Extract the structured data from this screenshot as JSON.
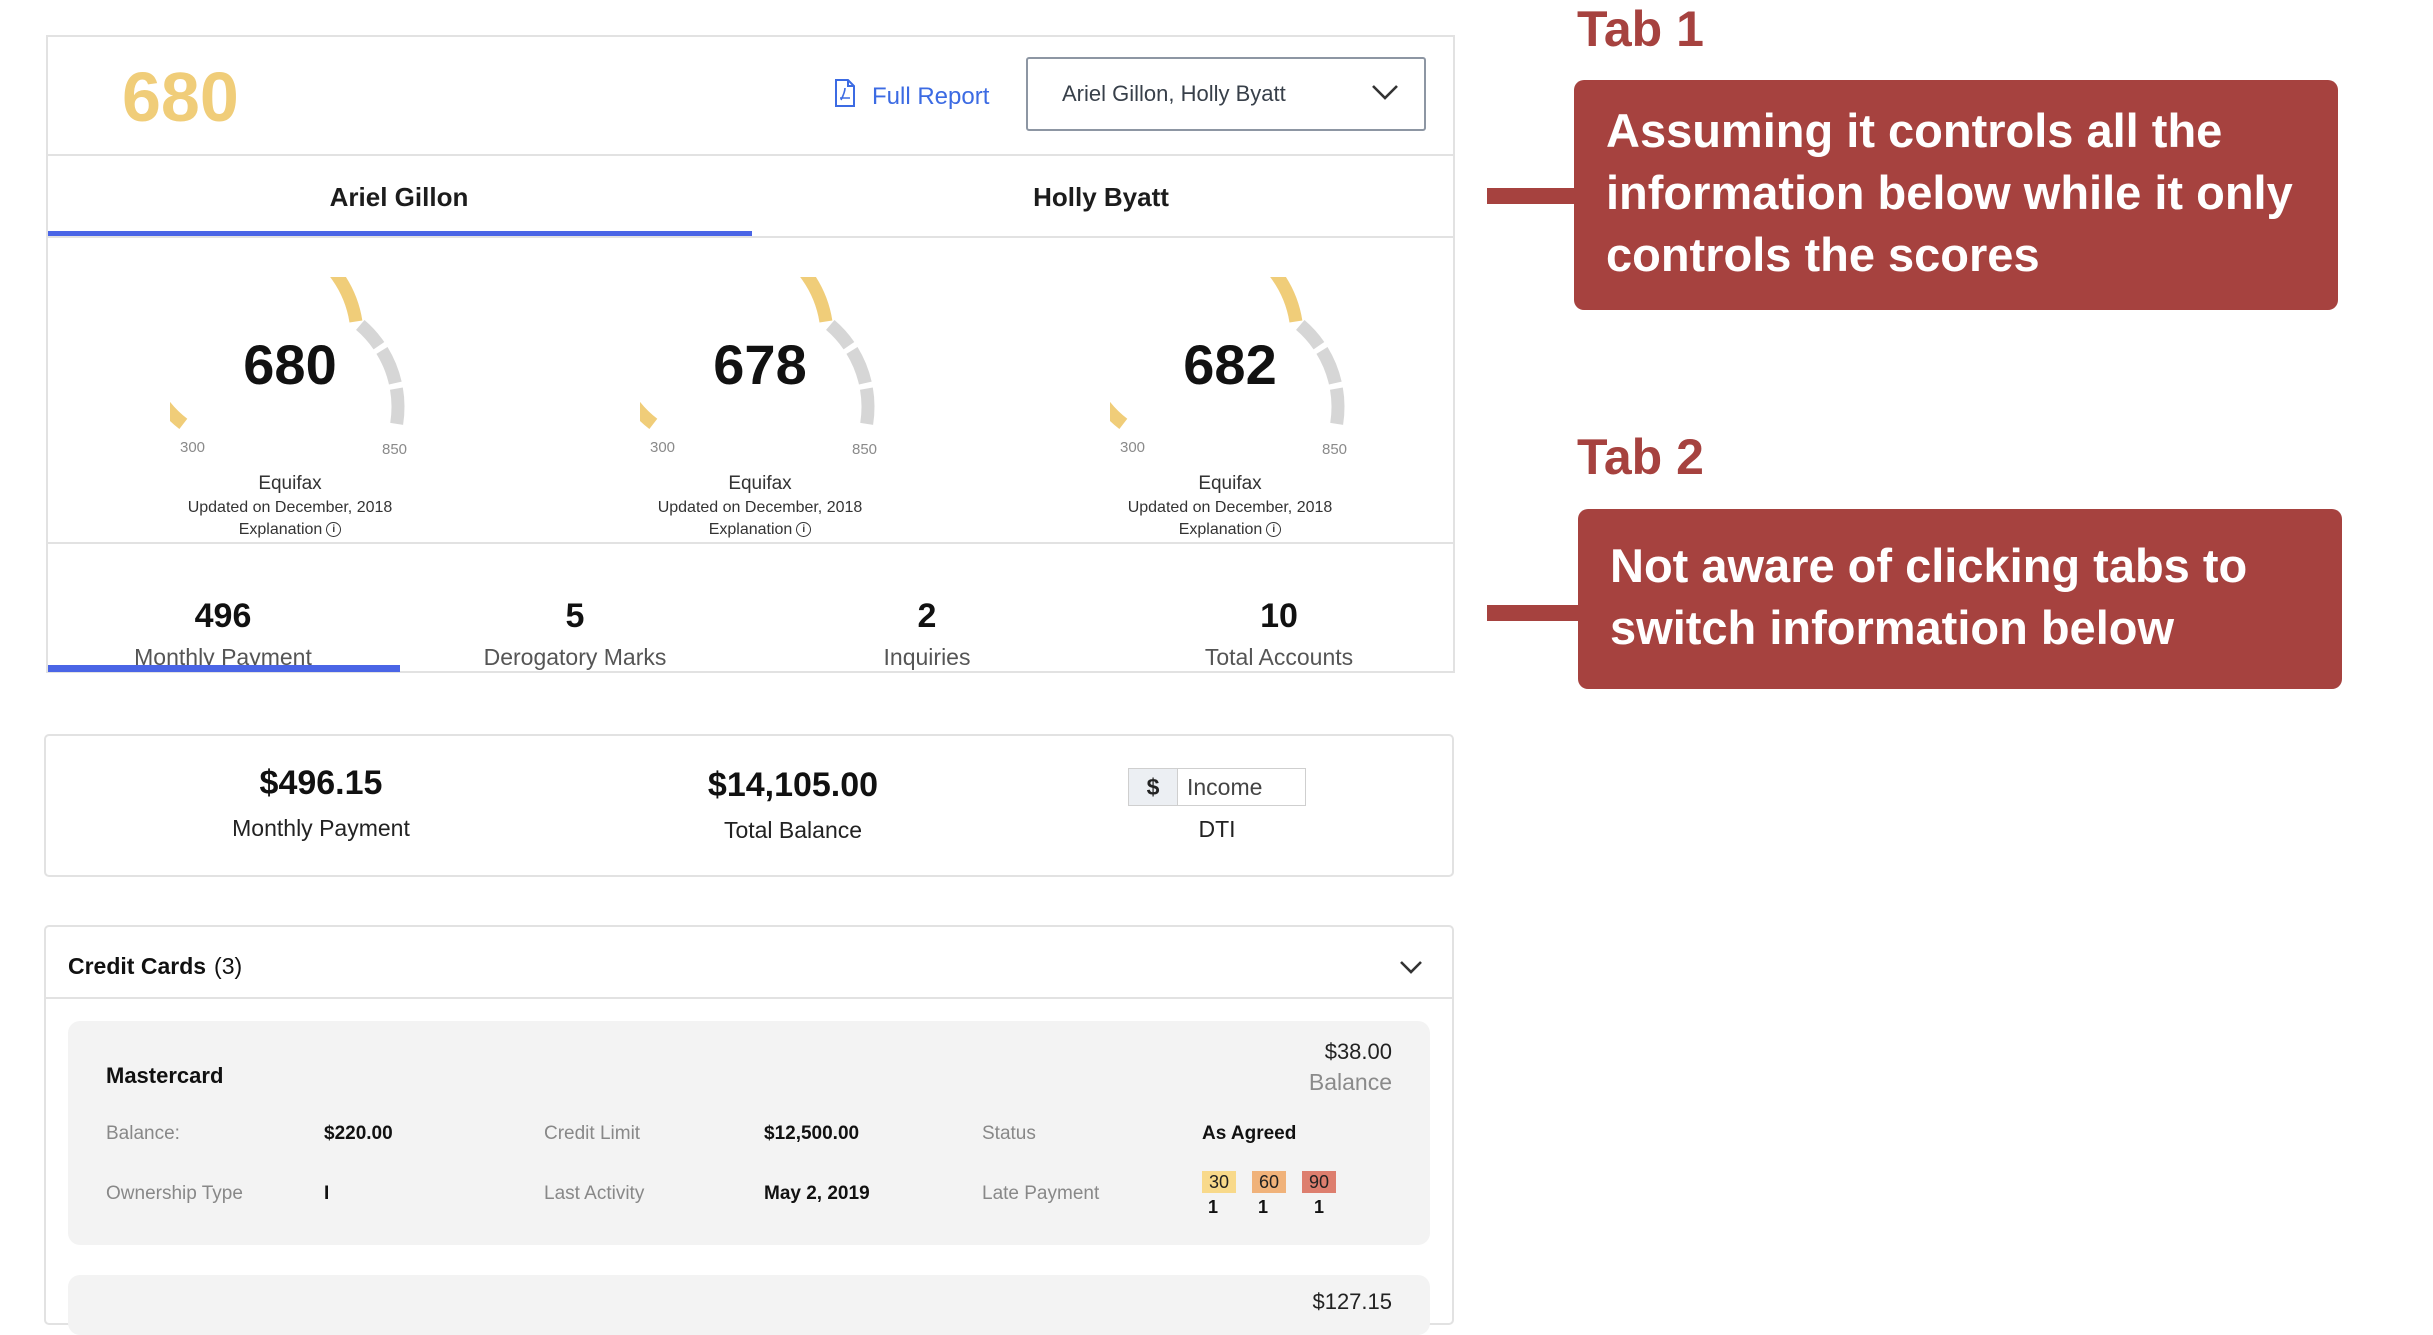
{
  "header": {
    "score": "680",
    "full_report_label": "Full Report",
    "applicant_select_value": "Ariel Gillon, Holly Byatt"
  },
  "tabs": [
    {
      "label": "Ariel Gillon",
      "active": true
    },
    {
      "label": "Holly Byatt",
      "active": false
    }
  ],
  "gauges": [
    {
      "score": "680",
      "min": "300",
      "max": "850",
      "bureau": "Equifax",
      "updated": "Updated on December, 2018",
      "explanation": "Explanation",
      "level": 0.69
    },
    {
      "score": "678",
      "min": "300",
      "max": "850",
      "bureau": "Equifax",
      "updated": "Updated on December, 2018",
      "explanation": "Explanation",
      "level": 0.69
    },
    {
      "score": "682",
      "min": "300",
      "max": "850",
      "bureau": "Equifax",
      "updated": "Updated on December, 2018",
      "explanation": "Explanation",
      "level": 0.69
    }
  ],
  "stats": [
    {
      "value": "496",
      "label": "Monthly Payment",
      "active": true
    },
    {
      "value": "5",
      "label": "Derogatory Marks",
      "active": false
    },
    {
      "value": "2",
      "label": "Inquiries",
      "active": false
    },
    {
      "value": "10",
      "label": "Total Accounts",
      "active": false
    }
  ],
  "summary": {
    "monthly_payment_value": "$496.15",
    "monthly_payment_label": "Monthly Payment",
    "total_balance_value": "$14,105.00",
    "total_balance_label": "Total Balance",
    "income_prefix": "$",
    "income_placeholder": "Income",
    "dti_label": "DTI"
  },
  "credit_cards": {
    "title": "Credit Cards",
    "count": "(3)",
    "accounts": [
      {
        "name": "Mastercard",
        "balance_value": "$38.00",
        "balance_label": "Balance",
        "fields": {
          "balance_label": "Balance:",
          "balance_value": "$220.00",
          "credit_limit_label": "Credit Limit",
          "credit_limit_value": "$12,500.00",
          "status_label": "Status",
          "status_value": "As Agreed",
          "ownership_label": "Ownership Type",
          "ownership_value": "I",
          "last_activity_label": "Last Activity",
          "last_activity_value": "May 2, 2019",
          "late_payment_label": "Late Payment"
        },
        "late_payments": [
          {
            "days": "30",
            "count": "1",
            "color": "#f8d98a"
          },
          {
            "days": "60",
            "count": "1",
            "color": "#f0b27a"
          },
          {
            "days": "90",
            "count": "1",
            "color": "#dd7e6e"
          }
        ]
      },
      {
        "balance_value": "$127.15"
      }
    ]
  },
  "annotations": [
    {
      "title": "Tab 1",
      "text": "Assuming it controls all the information below while it only controls the scores"
    },
    {
      "title": "Tab 2",
      "text": "Not aware of clicking tabs to switch information below"
    }
  ],
  "colors": {
    "accent_blue": "#4a65e6",
    "score_gold": "#f0cd79",
    "annotation_red": "#a6423f",
    "gauge_gray": "#d6d6d6"
  }
}
